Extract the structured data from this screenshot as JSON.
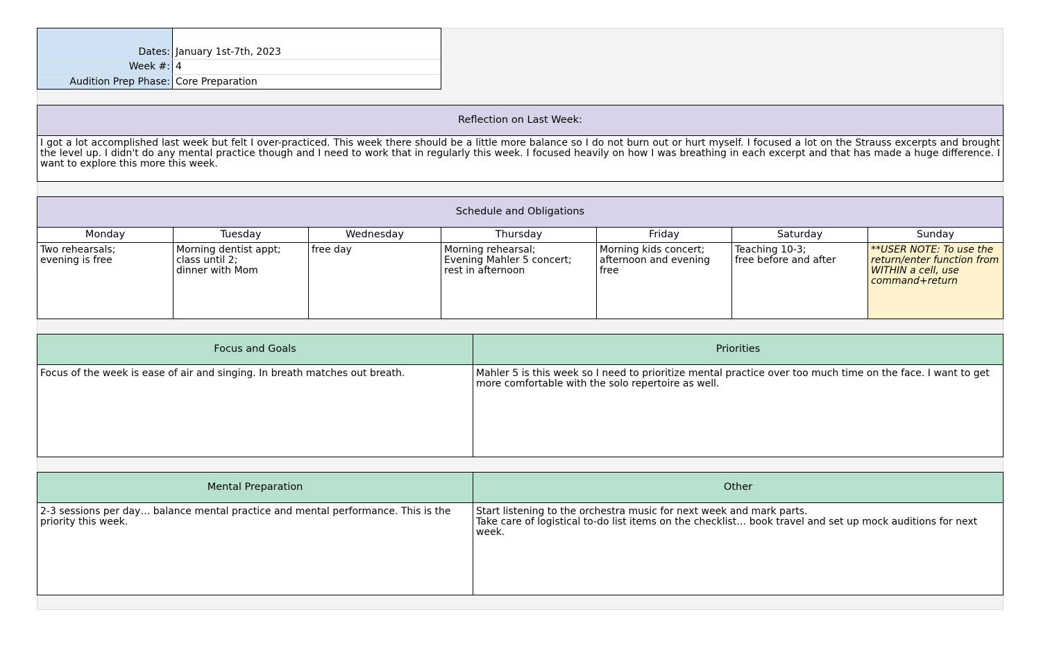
{
  "header_info": {
    "rows": [
      {
        "label": "Dates:",
        "value": "January 1st-7th, 2023"
      },
      {
        "label": "Week #:",
        "value": "4"
      },
      {
        "label": "Audition Prep Phase:",
        "value": "Core Preparation"
      }
    ]
  },
  "reflection": {
    "title": "Reflection on Last Week:",
    "text": "I got a lot accomplished last week but felt I over-practiced. This week there should be a little more balance so I do not burn out or hurt myself. I focused a lot on the Strauss excerpts and brought the level up. I didn't do any mental practice though and I need to work that in regularly this week. I focused heavily on how I was breathing in each excerpt and that has made a huge difference. I want to explore this more this week."
  },
  "schedule": {
    "title": "Schedule and Obligations",
    "days": [
      {
        "name": "Monday",
        "text": "Two rehearsals;\nevening is free"
      },
      {
        "name": "Tuesday",
        "text": "Morning dentist appt;\nclass until 2;\ndinner with Mom"
      },
      {
        "name": "Wednesday",
        "text": "free day"
      },
      {
        "name": "Thursday",
        "text": "Morning rehearsal;\nEvening Mahler 5 concert;\nrest in afternoon"
      },
      {
        "name": "Friday",
        "text": "Morning kids concert;\nafternoon and evening free"
      },
      {
        "name": "Saturday",
        "text": "Teaching 10-3;\nfree before and after"
      },
      {
        "name": "Sunday",
        "text": "**USER NOTE: To use the return/enter function from WITHIN a cell, use command+return"
      }
    ]
  },
  "focus": {
    "title": "Focus and Goals",
    "text": "Focus of the week is ease of air and singing. In breath matches out breath."
  },
  "priorities": {
    "title": "Priorities",
    "text": "Mahler 5 is this week so I need to prioritize mental practice over too much time on the face. I want to get more comfortable with the solo repertoire as well."
  },
  "mental": {
    "title": "Mental Preparation",
    "text": "2-3 sessions per day… balance mental practice and mental performance. This is the priority this week."
  },
  "other": {
    "title": "Other",
    "text": "Start listening to the orchestra music for next week and mark parts.\nTake care of logistical to-do list items on the checklist… book travel and set up mock auditions for next week."
  },
  "colors": {
    "purple_header": "#d9d2e9",
    "green_header": "#b7e1cd",
    "blue_label": "#cfe2f3",
    "note_yellow": "#fff2cc"
  }
}
